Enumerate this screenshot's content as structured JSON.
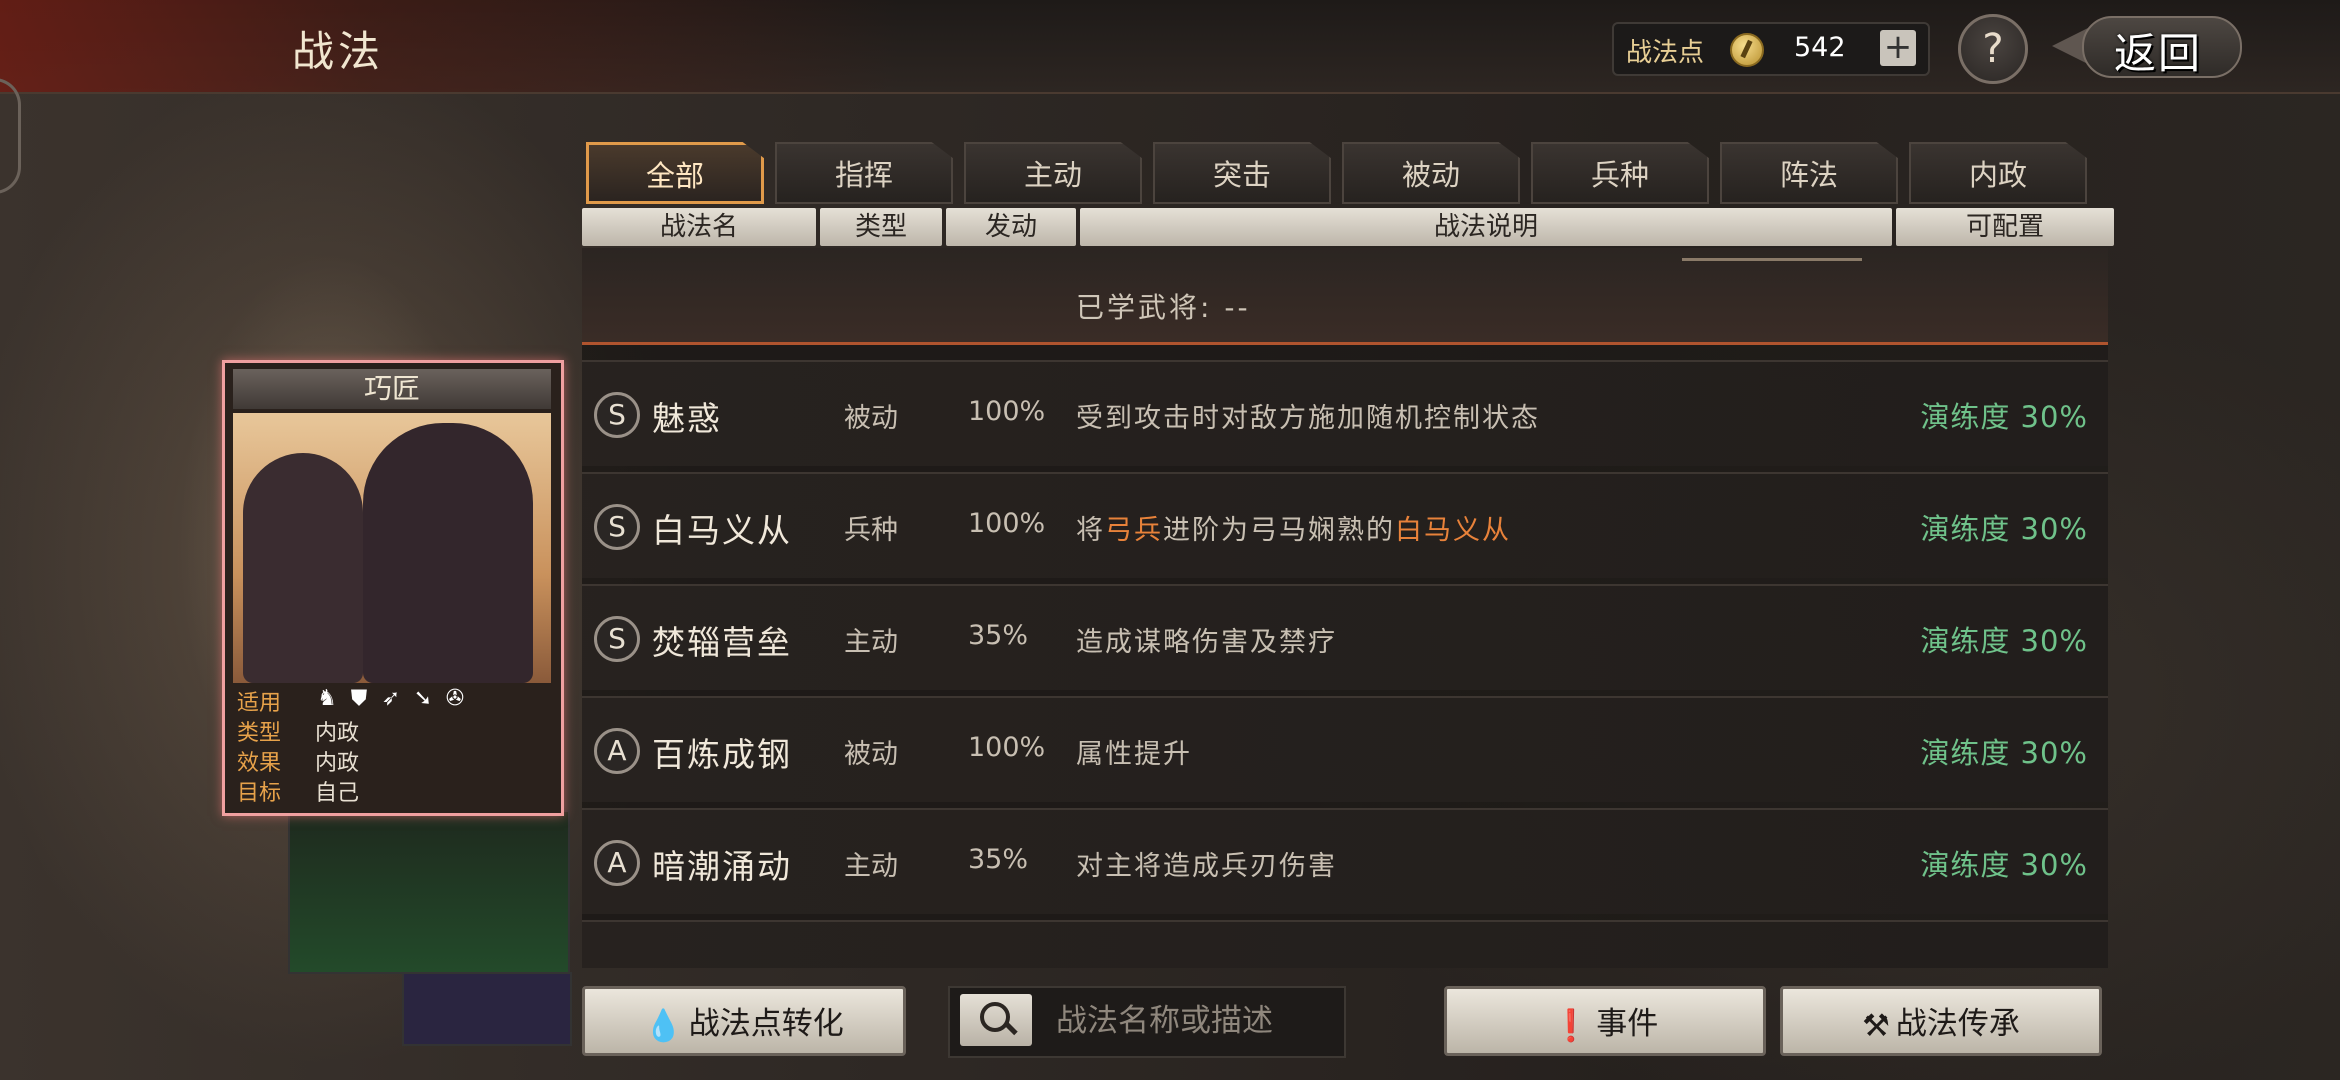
{
  "header": {
    "title": "战法",
    "points_label": "战法点",
    "points_value": "542",
    "plus": "+",
    "help": "?",
    "back_label": "返回"
  },
  "tabs": [
    {
      "label": "全部",
      "active": true
    },
    {
      "label": "指挥",
      "active": false
    },
    {
      "label": "主动",
      "active": false
    },
    {
      "label": "突击",
      "active": false
    },
    {
      "label": "被动",
      "active": false
    },
    {
      "label": "兵种",
      "active": false
    },
    {
      "label": "阵法",
      "active": false
    },
    {
      "label": "内政",
      "active": false
    }
  ],
  "columns": {
    "name": "战法名",
    "type": "类型",
    "trigger": "发动",
    "desc": "战法说明",
    "config": "可配置"
  },
  "learned": {
    "text": "已学武将:  --"
  },
  "skills": [
    {
      "grade": "S",
      "name": "魅惑",
      "type": "被动",
      "rate": "100%",
      "desc": "受到攻击时对敌方施加随机控制状态",
      "prof": "演练度 30%"
    },
    {
      "grade": "S",
      "name": "白马义从",
      "type": "兵种",
      "rate": "100%",
      "desc_parts": [
        "将",
        "弓兵",
        "进阶为弓马娴熟的",
        "白马义从"
      ],
      "prof": "演练度 30%"
    },
    {
      "grade": "S",
      "name": "焚辎营垒",
      "type": "主动",
      "rate": "35%",
      "desc": "造成谋略伤害及禁疗",
      "prof": "演练度 30%"
    },
    {
      "grade": "A",
      "name": "百炼成钢",
      "type": "被动",
      "rate": "100%",
      "desc": "属性提升",
      "prof": "演练度 30%"
    },
    {
      "grade": "A",
      "name": "暗潮涌动",
      "type": "主动",
      "rate": "35%",
      "desc": "对主将造成兵刃伤害",
      "prof": "演练度 30%"
    }
  ],
  "card": {
    "title": "巧匠",
    "applies_label": "适用",
    "type_label": "类型",
    "type_value": "内政",
    "effect_label": "效果",
    "effect_value": "内政",
    "target_label": "目标",
    "target_value": "自己",
    "troop_icons": [
      "cavalry-icon",
      "shield-icon",
      "bow-icon",
      "spear-icon",
      "wheel-icon"
    ]
  },
  "bottom": {
    "convert_label": "战法点转化",
    "search_placeholder": "战法名称或描述",
    "events_label": "事件",
    "inherit_label": "战法传承"
  },
  "colors": {
    "accent": "#e09a4a",
    "proficiency": "#6fc28a",
    "highlight": "#e8823a"
  }
}
